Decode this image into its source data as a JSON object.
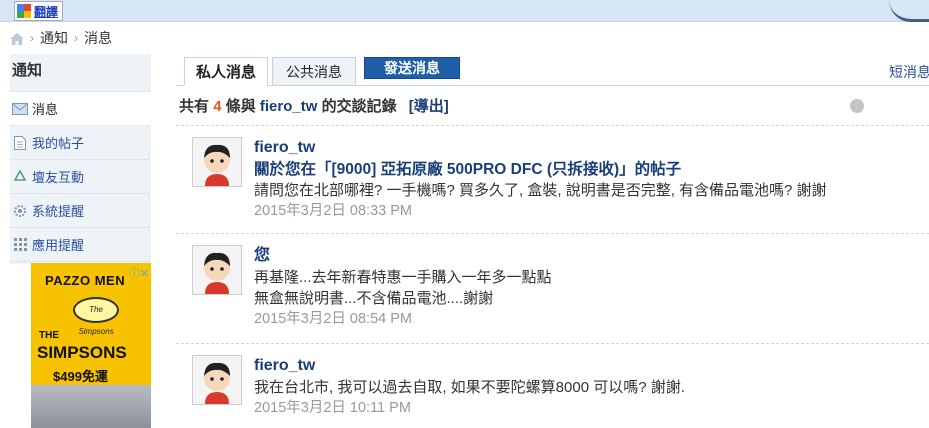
{
  "topbar": {
    "translate_label": "翻譯"
  },
  "breadcrumb": {
    "items": [
      "通知",
      "消息"
    ]
  },
  "sidebar": {
    "title": "通知",
    "items": [
      {
        "label": "消息",
        "icon": "envelope-icon"
      },
      {
        "label": "我的帖子",
        "icon": "document-icon"
      },
      {
        "label": "壇友互動",
        "icon": "recycle-icon"
      },
      {
        "label": "系統提醒",
        "icon": "gear-icon"
      },
      {
        "label": "應用提醒",
        "icon": "grid-icon"
      }
    ]
  },
  "ad": {
    "brand": "PAZZO MEN",
    "logo_text": "The Simpsons",
    "the_label": "THE",
    "title": "SIMPSONS",
    "price": "$499免運"
  },
  "tabs": {
    "private": "私人消息",
    "public": "公共消息",
    "send": "發送消息",
    "short": "短消息"
  },
  "summary": {
    "prefix": "共有",
    "count": "4",
    "middle": "條與",
    "username": "fiero_tw",
    "suffix": "的交談記錄",
    "export": "[導出]"
  },
  "messages": [
    {
      "user": "fiero_tw",
      "link": "關於您在「[9000] 亞拓原廠 500PRO DFC (只拆接收)」的帖子",
      "lines": [
        "請問您在北部哪裡? 一手機嗎? 買多久了, 盒裝, 說明書是否完整, 有含備品電池嗎? 謝謝"
      ],
      "time": "2015年3月2日 08:33 PM"
    },
    {
      "user": "您",
      "link": "",
      "lines": [
        "再基隆...去年新春特惠一手購入一年多一點點",
        "無盒無說明書...不含備品電池....謝謝"
      ],
      "time": "2015年3月2日 08:54 PM"
    },
    {
      "user": "fiero_tw",
      "link": "",
      "lines": [
        "我在台北市, 我可以過去自取, 如果不要陀螺算8000 可以嗎? 謝謝."
      ],
      "time": "2015年3月2日 10:11 PM"
    }
  ],
  "colors": {
    "accent_blue": "#1f5ea8",
    "link_blue": "#1a3e7a",
    "count_orange": "#e4561f",
    "ad_yellow": "#f7c300"
  }
}
